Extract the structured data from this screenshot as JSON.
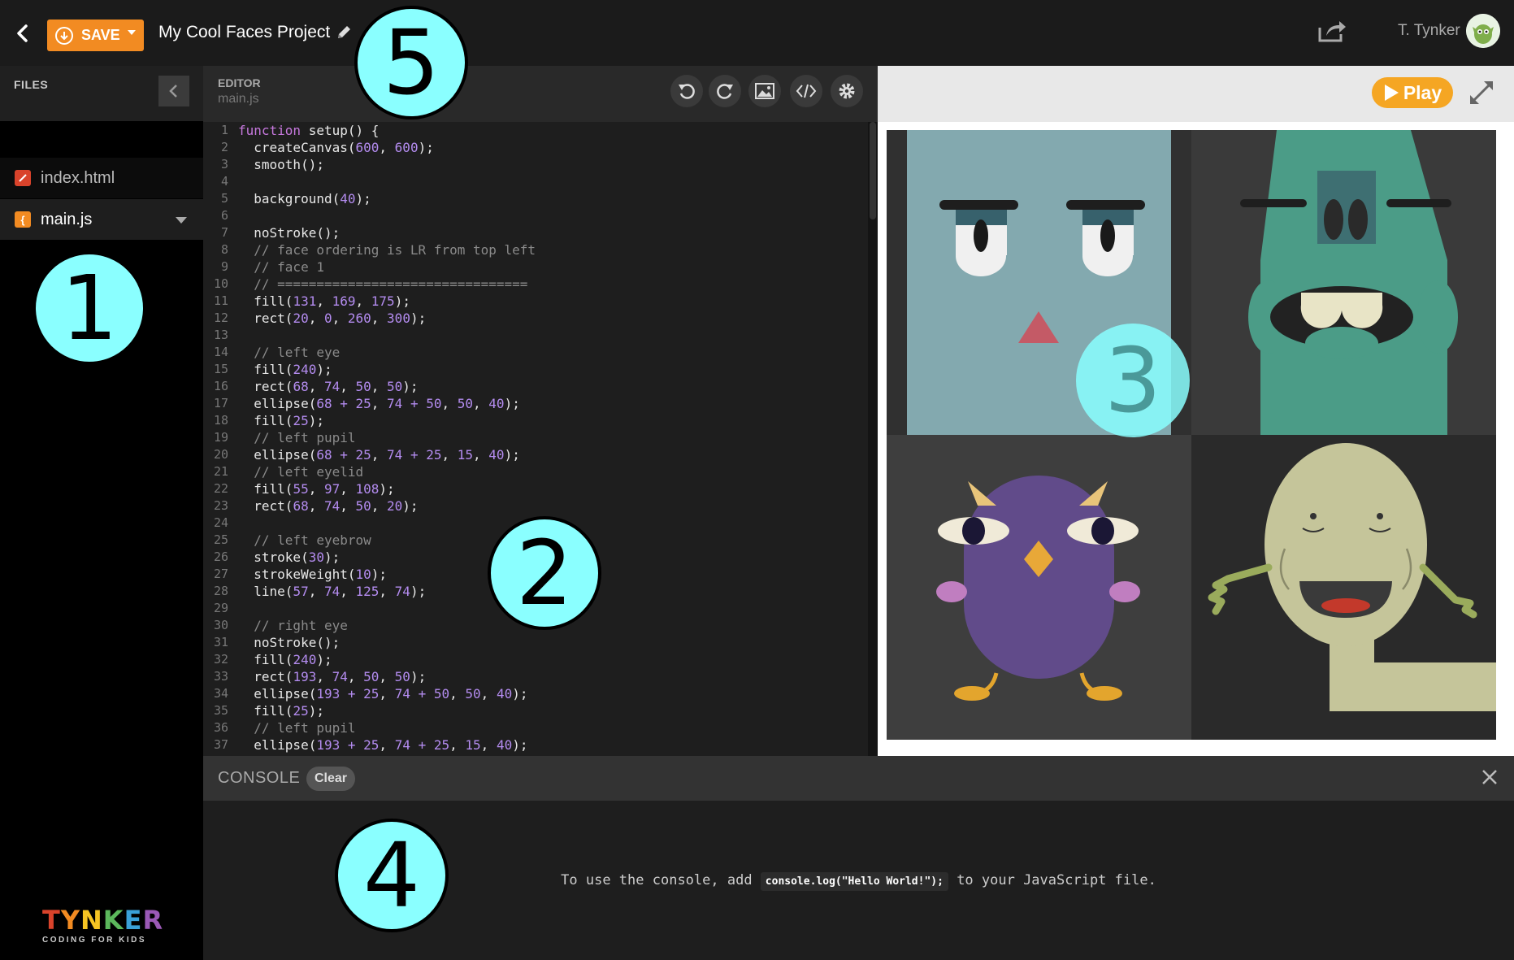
{
  "topbar": {
    "save_label": "SAVE",
    "project_title": "My Cool Faces Project",
    "user_name": "T. Tynker"
  },
  "sidebar": {
    "files_label": "FILES",
    "files": [
      {
        "name": "index.html",
        "icon": "html-file-icon",
        "color": "#d9432b"
      },
      {
        "name": "main.js",
        "icon": "js-file-icon",
        "color": "#f28b22"
      }
    ],
    "logo_text": "TYNKER",
    "logo_sub": "CODING FOR KIDS"
  },
  "editor": {
    "label": "EDITOR",
    "filename": "main.js",
    "lines": [
      "function setup() {",
      "  createCanvas(600, 600);",
      "  smooth();",
      "",
      "  background(40);",
      "",
      "  noStroke();",
      "  // face ordering is LR from top left",
      "  // face 1",
      "  // ================================",
      "  fill(131, 169, 175);",
      "  rect(20, 0, 260, 300);",
      "",
      "  // left eye",
      "  fill(240);",
      "  rect(68, 74, 50, 50);",
      "  ellipse(68 + 25, 74 + 50, 50, 40);",
      "  fill(25);",
      "  // left pupil",
      "  ellipse(68 + 25, 74 + 25, 15, 40);",
      "  // left eyelid",
      "  fill(55, 97, 108);",
      "  rect(68, 74, 50, 20);",
      "",
      "  // left eyebrow",
      "  stroke(30);",
      "  strokeWeight(10);",
      "  line(57, 74, 125, 74);",
      "",
      "  // right eye",
      "  noStroke();",
      "  fill(240);",
      "  rect(193, 74, 50, 50);",
      "  ellipse(193 + 25, 74 + 50, 50, 40);",
      "  fill(25);",
      "  // left pupil",
      "  ellipse(193 + 25, 74 + 25, 15, 40);"
    ]
  },
  "preview": {
    "play_label": "Play"
  },
  "console": {
    "label": "CONSOLE",
    "clear_label": "Clear",
    "msg_before": "To use the console, add ",
    "msg_code": "console.log(\"Hello World!\");",
    "msg_after": " to your JavaScript file."
  },
  "markers": [
    "1",
    "2",
    "3",
    "4",
    "5"
  ],
  "colors": {
    "accent": "#f28b22",
    "play": "#f5a623",
    "marker": "#8affff"
  }
}
